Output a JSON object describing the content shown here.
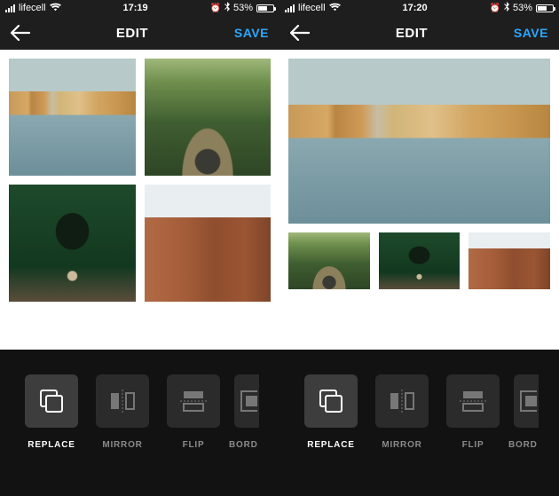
{
  "screens": [
    {
      "status": {
        "carrier": "lifecell",
        "time": "17:19",
        "battery": "53%"
      },
      "header": {
        "title": "EDIT",
        "save": "SAVE"
      },
      "tools": [
        {
          "key": "replace",
          "label": "REPLACE",
          "active": true
        },
        {
          "key": "mirror",
          "label": "MIRROR",
          "active": false
        },
        {
          "key": "flip",
          "label": "FLIP",
          "active": false
        },
        {
          "key": "border",
          "label": "BORD",
          "active": false,
          "clipped": true
        }
      ]
    },
    {
      "status": {
        "carrier": "lifecell",
        "time": "17:20",
        "battery": "53%"
      },
      "header": {
        "title": "EDIT",
        "save": "SAVE"
      },
      "tools": [
        {
          "key": "replace",
          "label": "REPLACE",
          "active": true
        },
        {
          "key": "mirror",
          "label": "MIRROR",
          "active": false
        },
        {
          "key": "flip",
          "label": "FLIP",
          "active": false
        },
        {
          "key": "border",
          "label": "BORD",
          "active": false,
          "clipped": true
        }
      ]
    }
  ]
}
